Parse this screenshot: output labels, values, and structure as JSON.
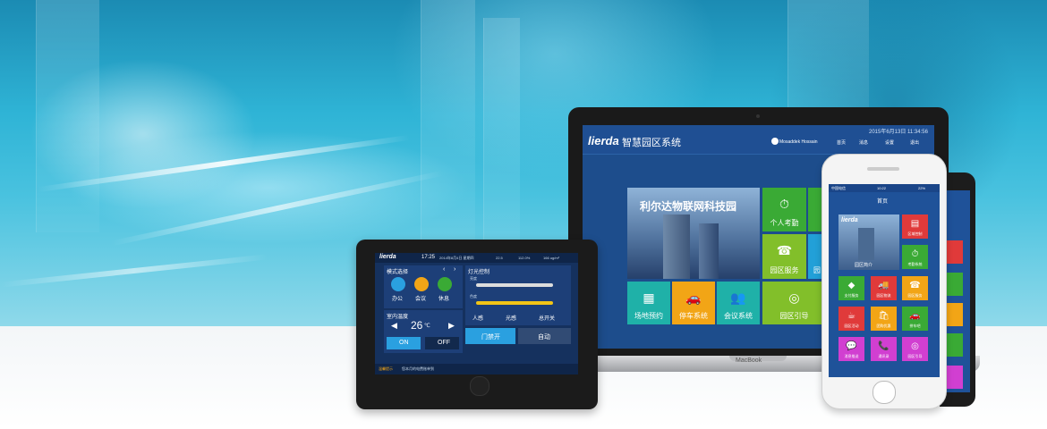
{
  "laptop": {
    "logo": "lierda",
    "title": "智慧园区系统",
    "datetime": "2015年6月13日 11:34:56",
    "user": "Mosaddek Hossain",
    "nav": [
      "首页",
      "消息",
      "设置",
      "退出"
    ],
    "banner_text": "利尔达物联网科技园",
    "brand_label": "MacBook",
    "tiles": [
      {
        "label": "个人考勤",
        "icon": "⏱",
        "color": "#3aaa35"
      },
      {
        "label": "园区服务",
        "icon": "☎",
        "color": "#22a0d8"
      },
      {
        "label": "园",
        "icon": "",
        "color": "#22a0d8"
      },
      {
        "label": "园区服务",
        "icon": "",
        "color": "#82bf2a"
      },
      {
        "label": "场地预约",
        "icon": "▦",
        "color": "#1fb1a8"
      },
      {
        "label": "停车系统",
        "icon": "🚗",
        "color": "#f2a516"
      },
      {
        "label": "会议系统",
        "icon": "👥",
        "color": "#1fb1a8"
      },
      {
        "label": "园区引导",
        "icon": "◎",
        "color": "#82bf2a"
      }
    ]
  },
  "tablet": {
    "logo": "lierda",
    "time": "17:25",
    "date": "2014年8月4日 星期四",
    "humidity": "22.5",
    "pm": "112.0%",
    "co2": "166 ug/m³",
    "mode_header": "模式选择",
    "modes": [
      "办公",
      "会议",
      "休息"
    ],
    "temp_header": "室内温度",
    "temp_value": "26",
    "temp_unit": "℃",
    "on_label": "ON",
    "off_label": "OFF",
    "light_header": "灯光控制",
    "brightness_label": "亮度",
    "color_label": "色度",
    "sensors": [
      "人感",
      "光感",
      "总开关"
    ],
    "door_label": "门禁开",
    "auto_label": "自动",
    "ticker_label": "温馨提示",
    "ticker_text": "您本月的电费账单到"
  },
  "phone": {
    "carrier": "中国电信",
    "time": "10:22",
    "battery": "22%",
    "header": "首页",
    "logo": "lierda",
    "intro_label": "园区简介",
    "tiles": [
      {
        "label": "区域控制",
        "icon": "▤",
        "color": "#e03a3a"
      },
      {
        "label": "考勤系统",
        "icon": "⏱",
        "color": "#3aaa35"
      },
      {
        "label": "支付服务",
        "icon": "◆",
        "color": "#3aaa35"
      },
      {
        "label": "园区物流",
        "icon": "🚚",
        "color": "#e03a3a"
      },
      {
        "label": "园区服务",
        "icon": "☎",
        "color": "#f2a516"
      },
      {
        "label": "园区活动",
        "icon": "☕",
        "color": "#e03a3a"
      },
      {
        "label": "团购优惠",
        "icon": "🛍",
        "color": "#f2a516"
      },
      {
        "label": "拼车吧",
        "icon": "🚗",
        "color": "#3aaa35"
      },
      {
        "label": "消息推送",
        "icon": "💬",
        "color": "#d13fd1"
      },
      {
        "label": "通讯录",
        "icon": "📞",
        "color": "#d13fd1"
      },
      {
        "label": "园区引导",
        "icon": "◎",
        "color": "#d13fd1"
      }
    ]
  }
}
